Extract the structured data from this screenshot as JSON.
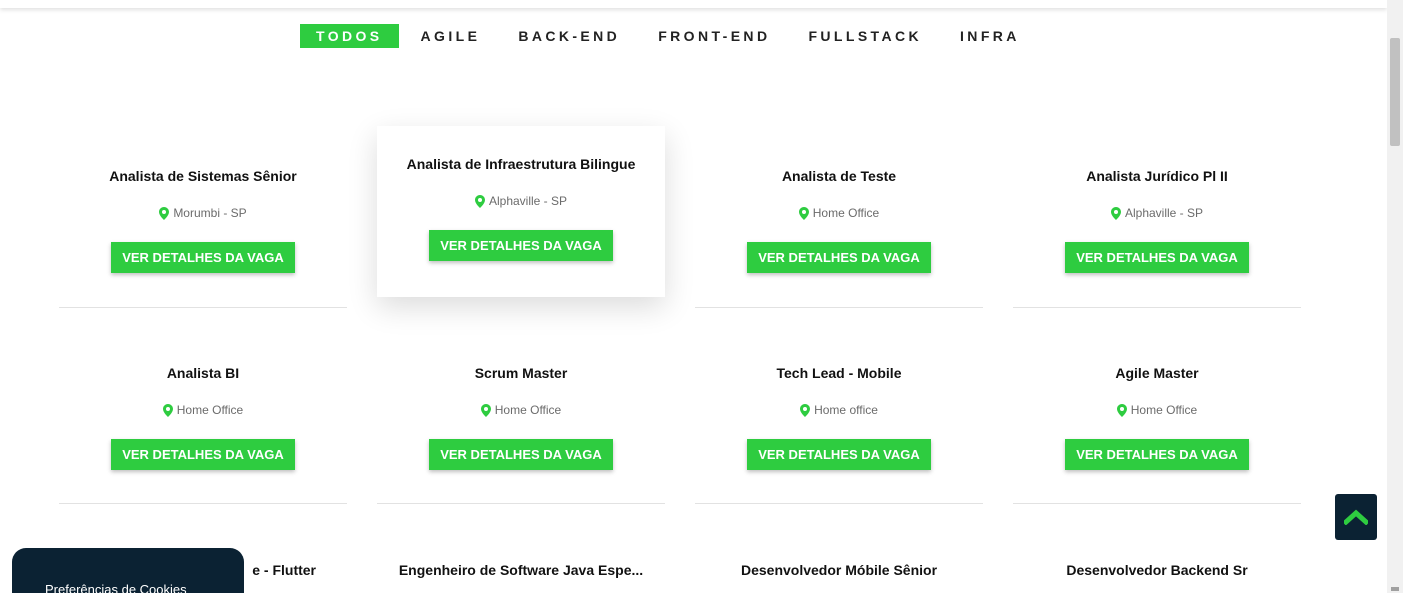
{
  "filters": [
    {
      "label": "TODOS",
      "active": true
    },
    {
      "label": "AGILE",
      "active": false
    },
    {
      "label": "BACK-END",
      "active": false
    },
    {
      "label": "FRONT-END",
      "active": false
    },
    {
      "label": "FULLSTACK",
      "active": false
    },
    {
      "label": "INFRA",
      "active": false
    }
  ],
  "jobs": [
    {
      "title": "Analista de Sistemas Sênior",
      "location": "Morumbi - SP",
      "button": "VER DETALHES DA VAGA"
    },
    {
      "title": "Analista de Infraestrutura Bilingue",
      "location": "Alphaville - SP",
      "button": "VER DETALHES DA VAGA"
    },
    {
      "title": "Analista de Teste",
      "location": "Home Office",
      "button": "VER DETALHES DA VAGA"
    },
    {
      "title": "Analista Jurídico Pl II",
      "location": "Alphaville - SP",
      "button": "VER DETALHES DA VAGA"
    },
    {
      "title": "Analista BI",
      "location": "Home Office",
      "button": "VER DETALHES DA VAGA"
    },
    {
      "title": "Scrum Master",
      "location": "Home Office",
      "button": "VER DETALHES DA VAGA"
    },
    {
      "title": "Tech Lead - Mobile",
      "location": "Home office",
      "button": "VER DETALHES DA VAGA"
    },
    {
      "title": "Agile Master",
      "location": "Home Office",
      "button": "VER DETALHES DA VAGA"
    },
    {
      "title": "e - Flutter",
      "location": "",
      "button": ""
    },
    {
      "title": "Engenheiro de Software Java Espe...",
      "location": "",
      "button": ""
    },
    {
      "title": "Desenvolvedor Móbile Sênior",
      "location": "",
      "button": ""
    },
    {
      "title": "Desenvolvedor Backend Sr",
      "location": "",
      "button": ""
    }
  ],
  "cookie_banner": {
    "label": "Preferências de Cookies"
  },
  "icons": {
    "location": "map-pin-icon",
    "scroll_top": "chevron-up-icon"
  },
  "colors": {
    "accent": "#2ecc40",
    "dark": "#0b2233"
  }
}
